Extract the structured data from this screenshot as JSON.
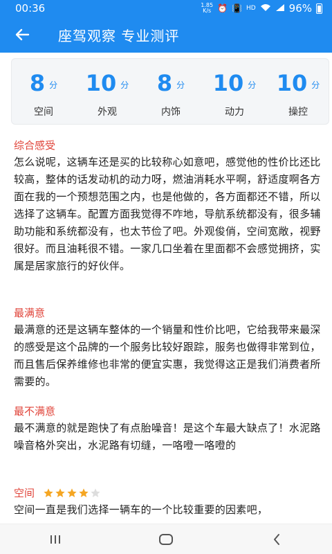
{
  "status": {
    "time": "00:36",
    "net_speed": "1.85\nK/s",
    "hd": "HD",
    "battery": "96%"
  },
  "header": {
    "title": "座驾观察 专业测评",
    "back_icon": "arrow-left-icon"
  },
  "scores": [
    {
      "value": "8",
      "unit": "分",
      "label": "空间"
    },
    {
      "value": "10",
      "unit": "分",
      "label": "外观"
    },
    {
      "value": "8",
      "unit": "分",
      "label": "内饰"
    },
    {
      "value": "10",
      "unit": "分",
      "label": "动力"
    },
    {
      "value": "10",
      "unit": "分",
      "label": "操控"
    }
  ],
  "sections": {
    "overall": {
      "title": "综合感受",
      "body": "怎么说呢，这辆车还是买的比较称心如意吧，感觉他的性价比还比较高，整体的话发动机的动力呀，燃油消耗水平啊，舒适度啊各方面在我的一个预想范围之内，也是他做的，各方面都还不错，所以选择了这辆车。配置方面我觉得不咋地，导航系统都没有，很多辅助功能和系统都没有，也太节俭了吧。外观俊俏，空间宽敞，视野很好。而且油耗很不错。一家几口坐着在里面都不会感觉拥挤，实属是居家旅行的好伙伴。"
    },
    "most_satisfied": {
      "title": "最满意",
      "body": "最满意的还是这辆车整体的一个销量和性价比吧，它给我带来最深的感受是这个品牌的一个服务比较好跟踪，服务也做得非常到位，而且售后保养维修也非常的便宜实惠，我觉得这正是我们消费者所需要的。"
    },
    "least_satisfied": {
      "title": "最不满意",
      "body": "最不满意的就是跑快了有点胎噪音！是这个车最大缺点了！水泥路噪音格外突出，水泥路有切缝，一咯噔一咯噔的"
    },
    "space": {
      "title": "空间",
      "rating": 4,
      "rating_max": 5,
      "body": "空间一直是我们选择一辆车的一个比较重要的因素吧，"
    }
  },
  "colors": {
    "primary": "#1f8bf0",
    "section_title": "#e0443a",
    "star_filled": "#f5a623",
    "star_empty": "#dddddd"
  }
}
